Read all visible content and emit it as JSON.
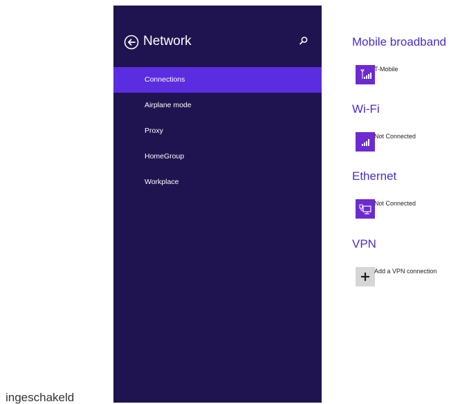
{
  "captions": {
    "top": "",
    "bottom": "ingeschakeld"
  },
  "sidebar": {
    "title": "Network",
    "back_icon": "back-arrow-circle-icon",
    "search_icon": "search-icon",
    "items": [
      {
        "label": "Connections",
        "selected": true
      },
      {
        "label": "Airplane mode",
        "selected": false
      },
      {
        "label": "Proxy",
        "selected": false
      },
      {
        "label": "HomeGroup",
        "selected": false
      },
      {
        "label": "Workplace",
        "selected": false
      }
    ]
  },
  "sections": {
    "mobile_broadband": {
      "title": "Mobile broadband",
      "connection": {
        "label": "T-Mobile",
        "icon": "cellular-signal-icon"
      }
    },
    "wifi": {
      "title": "Wi-Fi",
      "connection": {
        "label": "Not Connected",
        "icon": "wifi-signal-icon"
      }
    },
    "ethernet": {
      "title": "Ethernet",
      "connection": {
        "label": "Not Connected",
        "icon": "ethernet-icon"
      }
    },
    "vpn": {
      "title": "VPN",
      "connection": {
        "label": "Add a VPN connection",
        "icon": "plus-icon"
      }
    }
  },
  "colors": {
    "sidebar_bg": "#201450",
    "selected_bg": "#5b2de0",
    "accent": "#4b2ad0",
    "tile_bg": "#6d2ad0",
    "add_tile_bg": "#d6d6d6"
  }
}
